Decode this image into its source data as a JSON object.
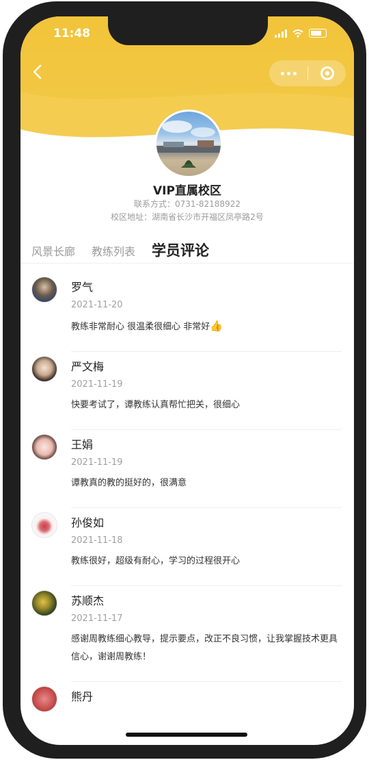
{
  "status_bar": {
    "time": "11:48"
  },
  "campus": {
    "name": "VIP直属校区",
    "contact": "联系方式：0731-82188922",
    "address": "校区地址：湖南省长沙市开福区凤亭路2号"
  },
  "tabs": [
    {
      "label": "风景长廊",
      "active": false
    },
    {
      "label": "教练列表",
      "active": false
    },
    {
      "label": "学员评论",
      "active": true
    }
  ],
  "comments": [
    {
      "name": "罗气",
      "date": "2021-11-20",
      "text": "教练非常耐心 很温柔很细心 非常好",
      "avatar_color": "#4a5a7a",
      "emoji": "👍"
    },
    {
      "name": "严文梅",
      "date": "2021-11-19",
      "text": "快要考试了，谭教练认真帮忙把关，很细心",
      "avatar_color": "#e8d8c8"
    },
    {
      "name": "王娟",
      "date": "2021-11-19",
      "text": "谭教真的教的挺好的，很满意",
      "avatar_color": "#f2d2cc"
    },
    {
      "name": "孙俊如",
      "date": "2021-11-18",
      "text": "教练很好，超级有耐心，学习的过程很开心",
      "avatar_color": "#f6eded"
    },
    {
      "name": "苏顺杰",
      "date": "2021-11-17",
      "text": "感谢周教练细心教导，提示要点，改正不良习惯，让我掌握技术更具信心，谢谢周教练！",
      "avatar_color": "#4a5a2a"
    },
    {
      "name": "熊丹",
      "date": "",
      "text": "",
      "avatar_color": "#c44a4a"
    }
  ],
  "colors": {
    "header": "#f1c43a",
    "text": "#222222",
    "muted": "#9a9a9a"
  }
}
